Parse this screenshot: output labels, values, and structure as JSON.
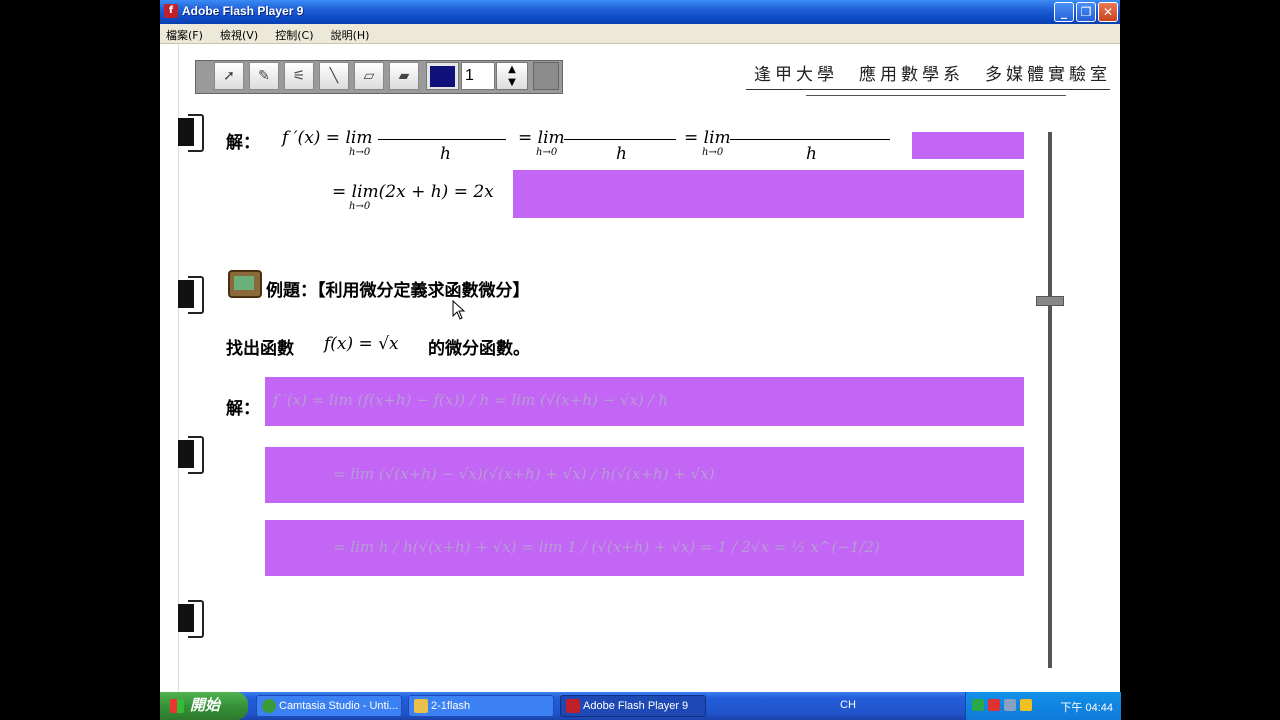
{
  "window": {
    "title": "Adobe Flash Player 9",
    "title_icon": "f"
  },
  "menu": {
    "items": [
      "檔案(F)",
      "檢視(V)",
      "控制(C)",
      "說明(H)"
    ]
  },
  "toolbar": {
    "tools": [
      "arrow-icon",
      "pencil-icon",
      "brush-icon",
      "line-icon",
      "eraser-icon",
      "clear-eraser-icon"
    ],
    "color": "#10107a",
    "line_width": "1",
    "stepper_up": "▲",
    "stepper_down": "▼"
  },
  "header": {
    "text": "逢甲大學　應用數學系　多媒體實驗室"
  },
  "content": {
    "solution_label_1": "解：",
    "formula_1": "f ′(x) = lim",
    "formula_1_sub": "h→0",
    "formula_1_h": "h",
    "formula_1b": "= lim",
    "formula_1c": "= lim",
    "formula_2": "= lim(2x + h) = 2x",
    "formula_2_sub": "h→0",
    "example_title": "例題：【利用微分定義求函數微分】",
    "problem_prefix": "找出函數",
    "problem_formula": "f(x) = √x",
    "problem_suffix": "的微分函數。",
    "solution_label_2": "解：",
    "hidden_1": "f ′(x) = lim  (f(x+h) − f(x)) / h  = lim  (√(x+h) − √x) / h",
    "hidden_2": "= lim  (√(x+h) − √x)(√(x+h) + √x) / h(√(x+h) + √x)",
    "hidden_3": "= lim  h / h(√(x+h) + √x)  = lim  1 / (√(x+h) + √x)  = 1 / 2√x  = ½ x^(−1/2)"
  },
  "taskbar": {
    "start": "開始",
    "tasks": [
      {
        "label": "Camtasia Studio - Unti...",
        "icon": "camtasia-icon"
      },
      {
        "label": "2-1flash",
        "icon": "folder-icon"
      },
      {
        "label": "Adobe Flash Player 9",
        "icon": "flash-icon"
      }
    ],
    "lang": "CH",
    "clock": "下午 04:44"
  },
  "colors": {
    "cover": "#c466f5",
    "titlebar": "#1f5fd6",
    "taskbar": "#245edb"
  }
}
